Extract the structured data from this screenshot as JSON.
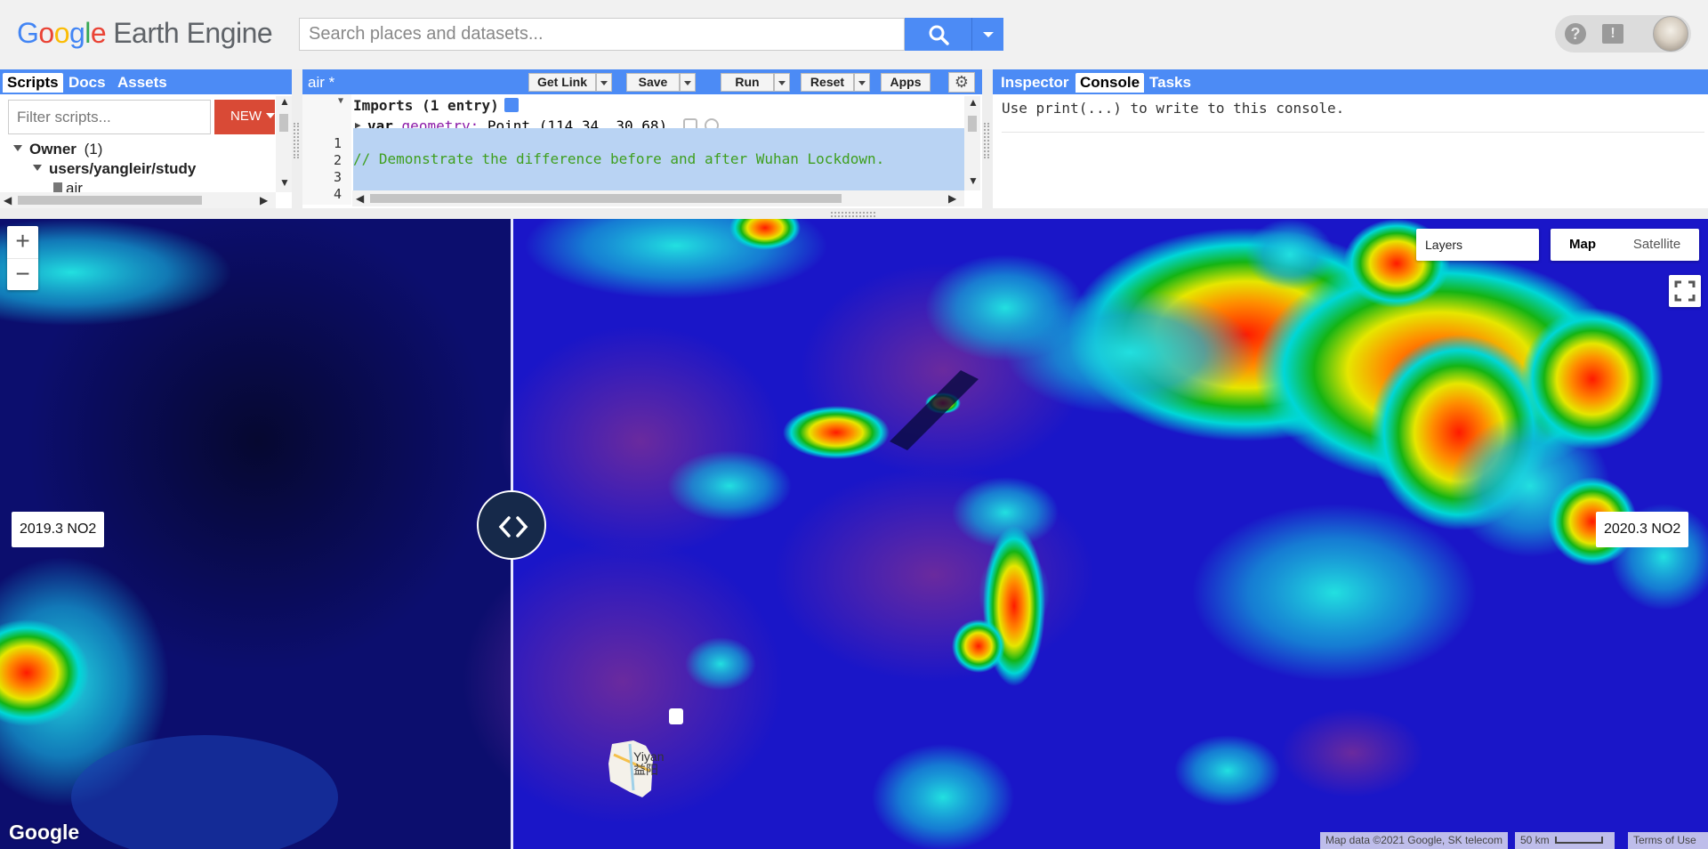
{
  "header": {
    "logo_google": "Google",
    "logo_product": "Earth Engine",
    "search_placeholder": "Search places and datasets...",
    "help_icon": "?",
    "feedback_icon": "!"
  },
  "left_panel": {
    "tabs": [
      "Scripts",
      "Docs",
      "Assets"
    ],
    "filter_placeholder": "Filter scripts...",
    "new_label": "NEW",
    "tree": {
      "owner": "Owner",
      "owner_count": "(1)",
      "repo": "users/yangleir/study",
      "file": "air"
    }
  },
  "editor": {
    "file_title": "air *",
    "buttons": {
      "get_link": "Get Link",
      "save": "Save",
      "run": "Run",
      "reset": "Reset",
      "apps": "Apps"
    },
    "imports_label": "Imports (1 entry)",
    "import_keyword": "var",
    "import_var": "geometry:",
    "import_value": "Point (114.34, 30.68)",
    "line_numbers": [
      "1",
      "2",
      "3",
      "4"
    ],
    "code_comment": "// Demonstrate the difference before and after Wuhan Lockdown."
  },
  "right_panel": {
    "tabs": [
      "Inspector",
      "Console",
      "Tasks"
    ],
    "console_message": "Use print(...) to write to this console."
  },
  "map": {
    "zoom_in": "+",
    "zoom_out": "−",
    "layers_label": "Layers",
    "map_types": [
      "Map",
      "Satellite"
    ],
    "left_label": "2019.3 NO2",
    "right_label": "2020.3 NO2",
    "city_label_en": "Yiyan",
    "city_label_cn": "益阳",
    "google_mark": "Google",
    "attribution": "Map data ©2021 Google, SK telecom",
    "scale": "50 km",
    "terms": "Terms of Use"
  },
  "colors": {
    "accent_blue": "#4c8bf5",
    "new_button_red": "#d94a36",
    "code_comment_green": "#3e9f1e",
    "selection_blue": "#b9d3f3",
    "map_base_blue": "#1a16c8"
  }
}
